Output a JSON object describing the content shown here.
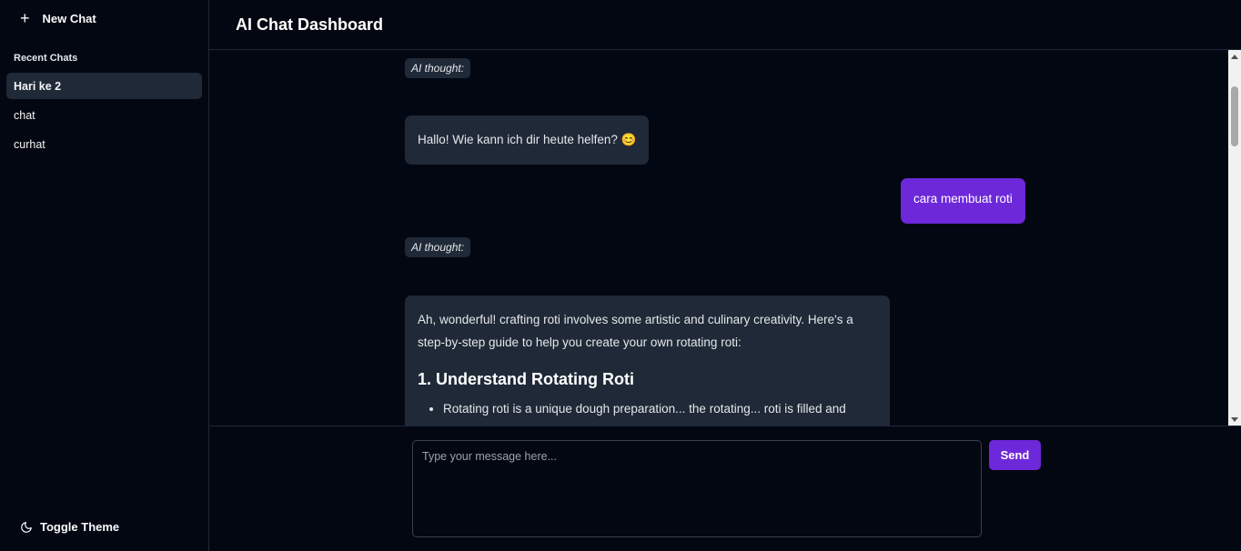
{
  "sidebar": {
    "new_chat_icon": "plus-icon",
    "new_chat_label": "New Chat",
    "recent_title": "Recent Chats",
    "chats": [
      {
        "label": "Hari ke 2",
        "active": true
      },
      {
        "label": "chat",
        "active": false
      },
      {
        "label": "curhat",
        "active": false
      }
    ],
    "toggle_theme_icon": "moon-icon",
    "toggle_theme_label": "Toggle Theme"
  },
  "header": {
    "title": "AI Chat Dashboard"
  },
  "messages": {
    "thought_1": "AI thought:",
    "ai_1": "Hallo! Wie kann ich dir heute helfen? 😊",
    "user_1": "cara membuat roti",
    "thought_2": "AI thought:",
    "ai_2_paragraph": "Ah, wonderful! crafting roti involves some artistic and culinary creativity. Here's a step-by-step guide to help you create your own rotating roti:",
    "ai_2_heading": "1. Understand Rotating Roti",
    "ai_2_list_item": "Rotating roti is a unique dough preparation... the rotating... roti is filled and"
  },
  "composer": {
    "placeholder": "Type your message here...",
    "send_label": "Send"
  },
  "colors": {
    "background": "#030712",
    "panel": "#1f2937",
    "accent": "#6d28d9"
  }
}
